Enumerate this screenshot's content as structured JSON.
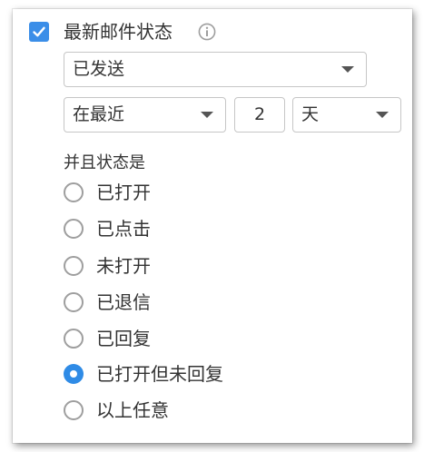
{
  "filter": {
    "title": "最新邮件状态",
    "enabled": true,
    "info_icon": "info-icon",
    "status_select": {
      "value": "已发送"
    },
    "range_select": {
      "value": "在最近"
    },
    "amount_input": {
      "value": "2"
    },
    "unit_select": {
      "value": "天"
    },
    "subheading": "并且状态是",
    "options": [
      {
        "label": "已打开",
        "selected": false
      },
      {
        "label": "已点击",
        "selected": false
      },
      {
        "label": "未打开",
        "selected": false
      },
      {
        "label": "已退信",
        "selected": false
      },
      {
        "label": "已回复",
        "selected": false
      },
      {
        "label": "已打开但未回复",
        "selected": true
      },
      {
        "label": "以上任意",
        "selected": false
      }
    ]
  },
  "colors": {
    "accent": "#3b8ee8",
    "text": "#333333",
    "border": "#c6c6c6",
    "radio_border": "#9e9e9e"
  }
}
